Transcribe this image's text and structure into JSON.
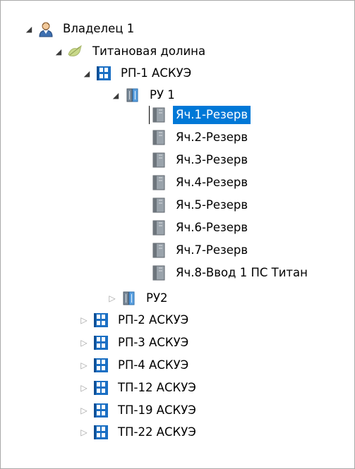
{
  "tree": {
    "owner": {
      "label": "Владелец 1",
      "icon": "owner-person-icon",
      "expanded": true
    },
    "valley": {
      "label": "Титановая долина",
      "icon": "location-leaf-icon",
      "expanded": true
    },
    "rp1": {
      "label": "РП-1 АСКУЭ",
      "icon": "substation-icon",
      "expanded": true
    },
    "ru1": {
      "label": "РУ 1",
      "icon": "switchgear-icon",
      "expanded": true
    },
    "cells": [
      {
        "label": "Яч.1-Резерв",
        "icon": "cabinet-icon",
        "selected": true
      },
      {
        "label": "Яч.2-Резерв",
        "icon": "cabinet-icon"
      },
      {
        "label": "Яч.3-Резерв",
        "icon": "cabinet-icon"
      },
      {
        "label": "Яч.4-Резерв",
        "icon": "cabinet-icon"
      },
      {
        "label": "Яч.5-Резерв",
        "icon": "cabinet-icon"
      },
      {
        "label": "Яч.6-Резерв",
        "icon": "cabinet-icon"
      },
      {
        "label": "Яч.7-Резерв",
        "icon": "cabinet-icon"
      },
      {
        "label": "Яч.8-Ввод 1 ПС Титан",
        "icon": "cabinet-icon"
      }
    ],
    "ru2": {
      "label": "РУ2",
      "icon": "switchgear-icon",
      "expanded": false
    },
    "stations": [
      {
        "label": "РП-2 АСКУЭ",
        "icon": "substation-icon",
        "expanded": false
      },
      {
        "label": "РП-3 АСКУЭ",
        "icon": "substation-icon",
        "expanded": false
      },
      {
        "label": "РП-4 АСКУЭ",
        "icon": "substation-icon",
        "expanded": false
      },
      {
        "label": "ТП-12 АСКУЭ",
        "icon": "substation-icon",
        "expanded": false
      },
      {
        "label": "ТП-19 АСКУЭ",
        "icon": "substation-icon",
        "expanded": false
      },
      {
        "label": "ТП-22 АСКУЭ",
        "icon": "substation-icon",
        "expanded": false
      }
    ],
    "expand_glyph": "◢",
    "collapse_glyph": "▷"
  },
  "colors": {
    "selection": "#0078d7",
    "substation_blue": "#1a6fc4",
    "border": "#a9a9a9"
  }
}
